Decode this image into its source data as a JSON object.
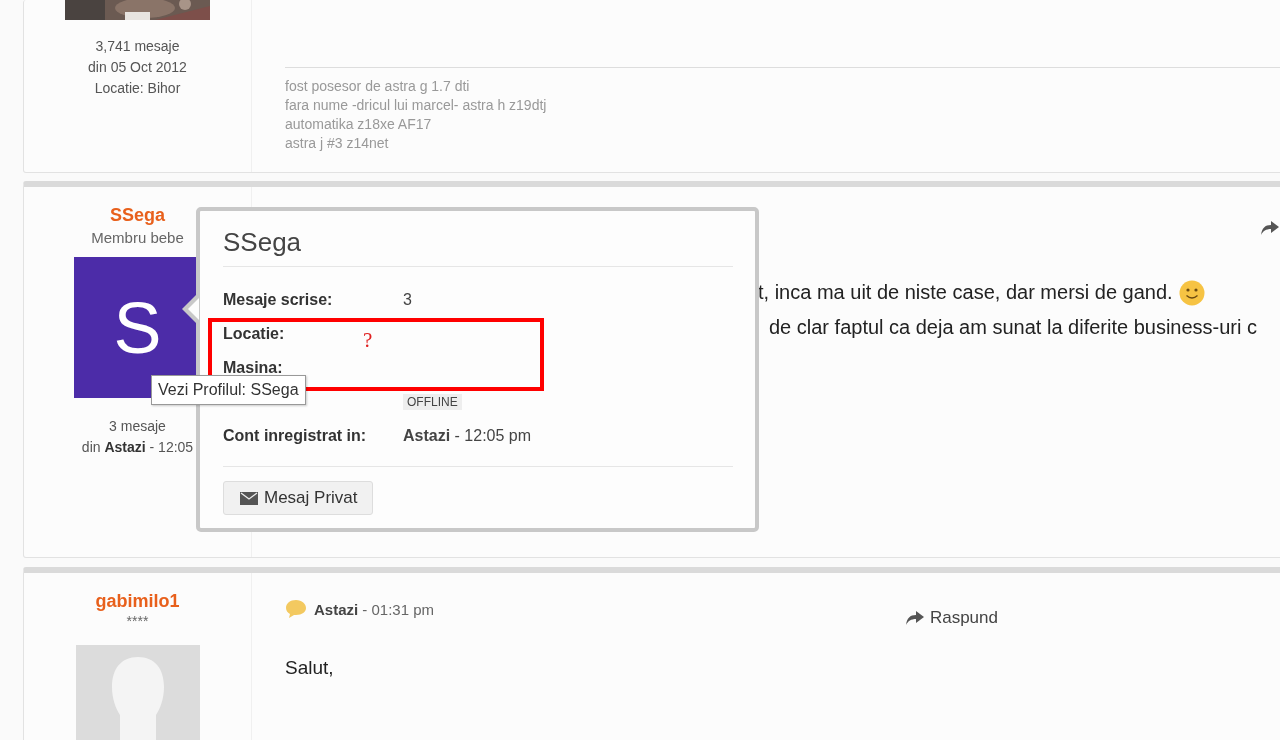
{
  "posts": [
    {
      "kind": "signature",
      "avatar": {
        "kind": "picture"
      },
      "stats": [
        "3,741 mesaje",
        "din 05 Oct 2012",
        "Locatie: Bihor"
      ],
      "signature": [
        "fost posesor de astra g 1.7 dti",
        "fara nume -dricul lui marcel- astra h z19dtj",
        "automatika z18xe AF17",
        "astra j #3 z14net"
      ]
    },
    {
      "kind": "hovered",
      "author": "SSega",
      "rank": "Membru bebe",
      "avatar": {
        "kind": "letter",
        "letter": "S"
      },
      "stats": [
        "3 mesaje",
        "din **Astazi** - 12:05"
      ],
      "reply_icon": true,
      "body": [
        {
          "text": "t, inca ma uit de niste case, dar mersi de gand.",
          "smiley": true
        },
        {
          "text": "de clar faptul ca deja am sunat la diferite business-uri c",
          "smiley": false
        }
      ]
    },
    {
      "kind": "header",
      "author": "gabimilo1",
      "rank": "****",
      "avatar": {
        "kind": "placeholder"
      },
      "date": "Astazi",
      "time": "- 01:31 pm",
      "reply": "Raspund",
      "body": [
        {
          "text": "Salut,"
        }
      ]
    }
  ],
  "popover": {
    "title": "SSega",
    "rows": [
      {
        "kind": "text",
        "label": "Mesaje scrise:",
        "value": "3"
      },
      {
        "kind": "empty",
        "label": "Locatie:"
      },
      {
        "kind": "empty",
        "label": "Masina:"
      },
      {
        "kind": "badge",
        "value": "OFFLINE"
      },
      {
        "kind": "text",
        "label": "Cont inregistrat in:",
        "value": "**Astazi** - 12:05 pm"
      }
    ],
    "button": "Mesaj Privat"
  },
  "tooltip": "Vezi Profilul: SSega",
  "annotation": {
    "mark": "?"
  }
}
